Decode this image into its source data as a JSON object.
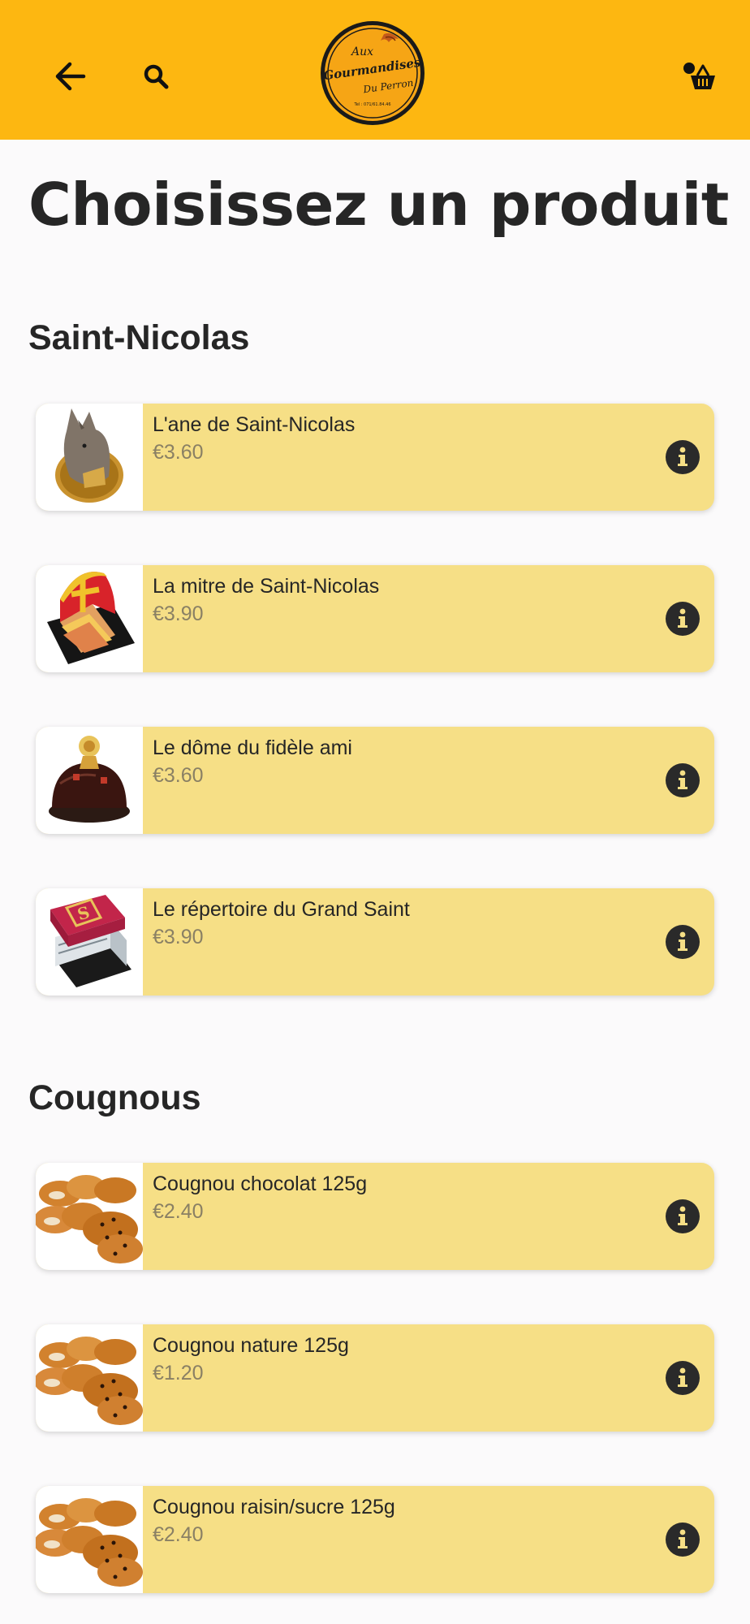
{
  "header": {
    "back_icon": "arrow-left-icon",
    "search_icon": "search-icon",
    "cart_icon": "basket-icon",
    "logo": {
      "line1": "Aux",
      "line2": "Gourmandises",
      "line3": "Du Perron",
      "phone": "Tel : 071/61.84.46"
    },
    "background_color": "#fdb711"
  },
  "page_title": "Choisissez un produit",
  "sections": [
    {
      "title": "Saint-Nicolas",
      "items": [
        {
          "name": "L'ane de Saint-Nicolas",
          "price": "€3.60",
          "image": "donkey-cake-image"
        },
        {
          "name": "La mitre de Saint-Nicolas",
          "price": "€3.90",
          "image": "mitre-cake-image"
        },
        {
          "name": "Le dôme du fidèle ami",
          "price": "€3.60",
          "image": "dome-cake-image"
        },
        {
          "name": "Le répertoire du Grand Saint",
          "price": "€3.90",
          "image": "book-cake-image"
        }
      ]
    },
    {
      "title": "Cougnous",
      "items": [
        {
          "name": "Cougnou chocolat 125g",
          "price": "€2.40",
          "image": "cougnou-image"
        },
        {
          "name": "Cougnou nature 125g",
          "price": "€1.20",
          "image": "cougnou-image"
        },
        {
          "name": "Cougnou raisin/sucre 125g",
          "price": "€2.40",
          "image": "cougnou-image"
        }
      ]
    }
  ],
  "colors": {
    "accent": "#fdb711",
    "card": "#f6df86",
    "info_button": "#2a2a2a",
    "price_text": "#8a8064"
  }
}
